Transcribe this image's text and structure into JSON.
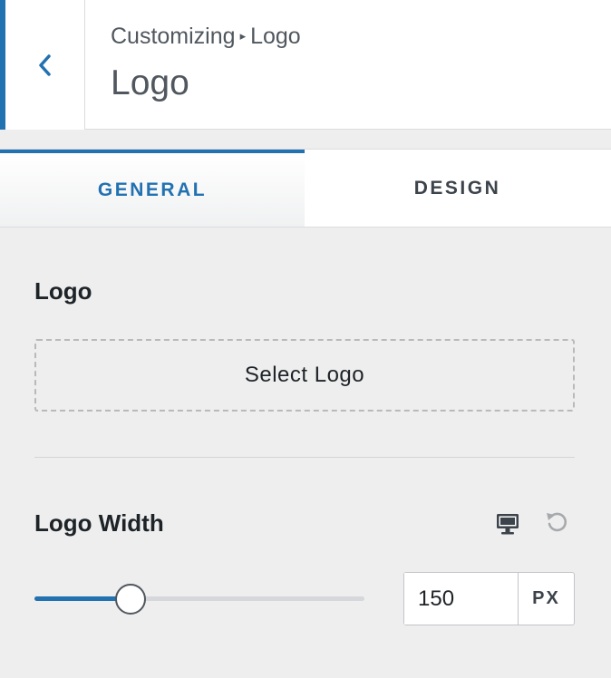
{
  "header": {
    "breadcrumb_root": "Customizing",
    "breadcrumb_separator": "▸",
    "breadcrumb_current": "Logo",
    "title": "Logo",
    "back_icon": "chevron-left-icon"
  },
  "tabs": [
    {
      "label": "GENERAL",
      "active": true
    },
    {
      "label": "DESIGN",
      "active": false
    }
  ],
  "logo_section": {
    "label": "Logo",
    "select_button": "Select Logo"
  },
  "logo_width": {
    "label": "Logo Width",
    "device_icon": "desktop-icon",
    "reset_icon": "reset-icon",
    "value": "150",
    "unit": "PX",
    "slider_fraction": 0.29
  },
  "colors": {
    "accent": "#2271b1",
    "panel_bg": "#eeeeee",
    "text": "#1d2327"
  }
}
